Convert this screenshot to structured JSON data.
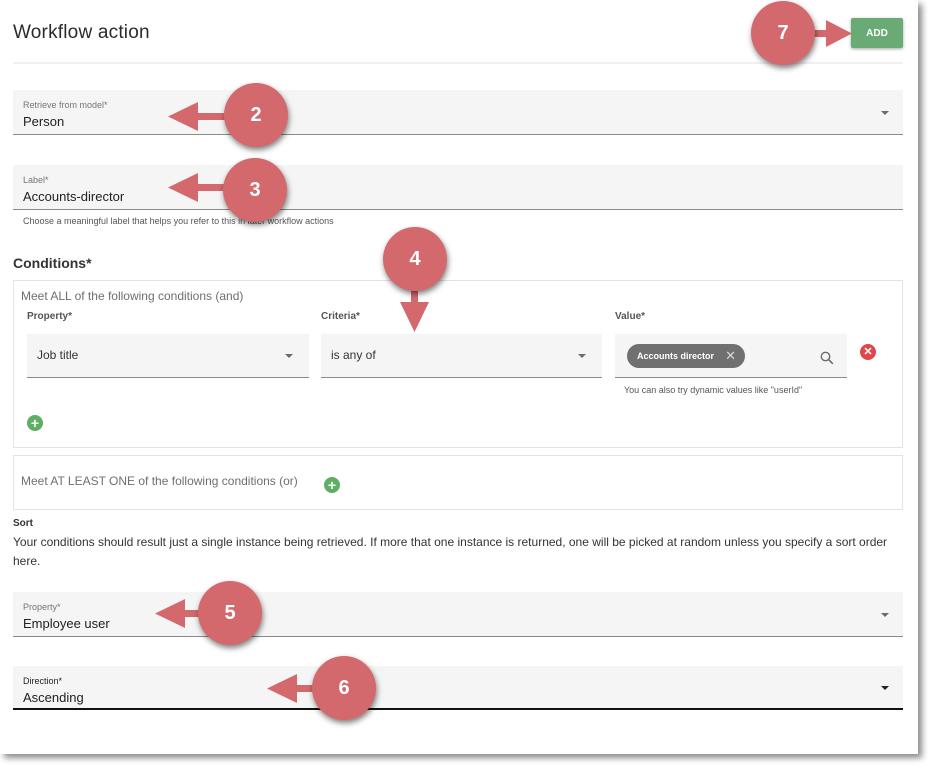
{
  "header": {
    "title": "Workflow action",
    "add_label": "ADD",
    "add_color": "#6aaa74"
  },
  "retrieve": {
    "label": "Retrieve from model*",
    "value": "Person"
  },
  "label_field": {
    "label": "Label*",
    "value": "Accounts-director",
    "hint": "Choose a meaningful label that helps you refer to this in later workflow actions"
  },
  "conditions": {
    "title": "Conditions*",
    "all_group": {
      "title": "Meet ALL of the following conditions (and)",
      "columns": {
        "property": "Property*",
        "criteria": "Criteria*",
        "value": "Value*"
      },
      "row": {
        "property": "Job title",
        "criteria": "is any of",
        "value_chip": "Accounts director",
        "value_hint": "You can also try dynamic values like \"userId\""
      }
    },
    "any_group": {
      "title": "Meet AT LEAST ONE of the following conditions (or)"
    }
  },
  "sort": {
    "title": "Sort",
    "description": "Your conditions should result just a single instance being retrieved. If more that one instance is returned, one will be picked at random unless you specify a sort order here.",
    "property": {
      "label": "Property*",
      "value": "Employee user"
    },
    "direction": {
      "label": "Direction*",
      "value": "Ascending"
    }
  },
  "callouts": [
    "2",
    "3",
    "4",
    "5",
    "6",
    "7"
  ],
  "icons": {
    "dropdown": "caret-down-icon",
    "search": "search-icon",
    "remove": "remove-circle-icon",
    "add": "add-circle-icon",
    "chip_remove": "close-icon"
  },
  "colors": {
    "callout": "#d4696d",
    "green": "#5fae65",
    "red": "#e0474c"
  }
}
